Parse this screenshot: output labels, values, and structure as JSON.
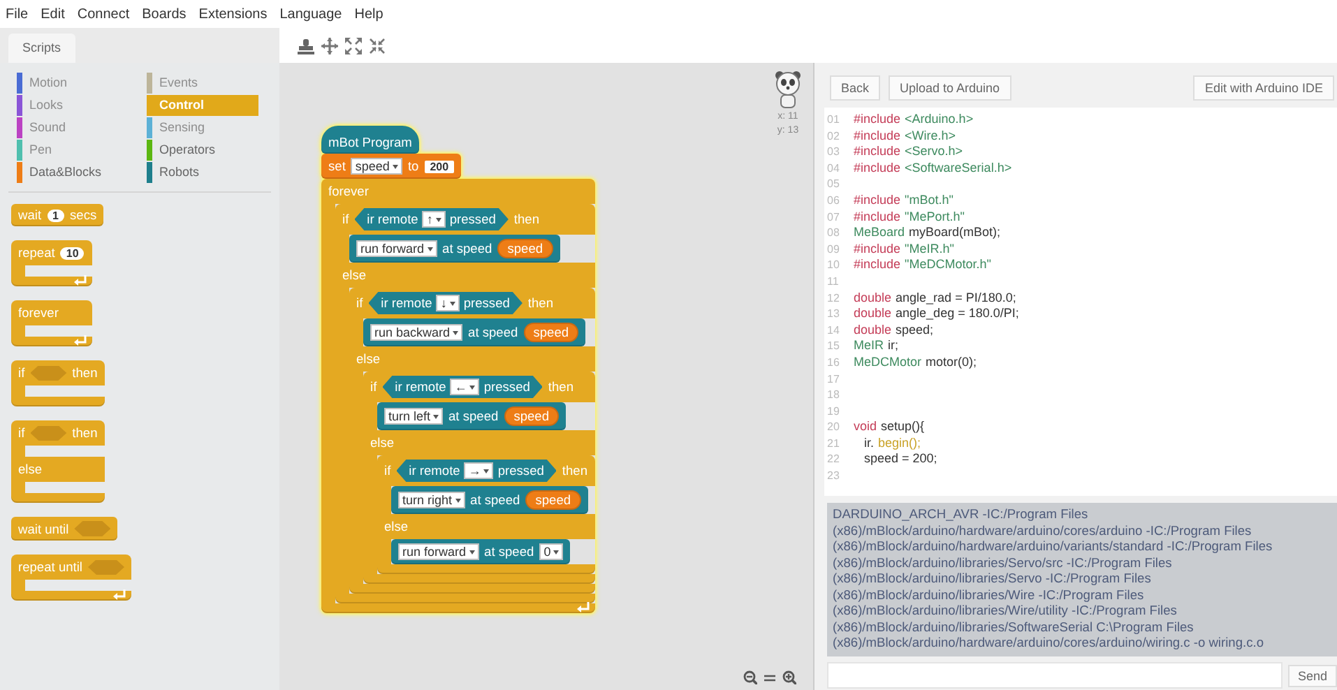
{
  "menu": [
    "File",
    "Edit",
    "Connect",
    "Boards",
    "Extensions",
    "Language",
    "Help"
  ],
  "tabs": [
    {
      "label": "Scripts",
      "selected": true
    }
  ],
  "palette": {
    "categories": [
      {
        "label": "Motion",
        "color": "#4a6cd4",
        "selected": false,
        "disabled": true
      },
      {
        "label": "Events",
        "color": "#bdb59a",
        "selected": false,
        "disabled": true
      },
      {
        "label": "Looks",
        "color": "#8a55d7",
        "selected": false,
        "disabled": true
      },
      {
        "label": "Control",
        "color": "#e1a91a",
        "selected": true,
        "disabled": false
      },
      {
        "label": "Sound",
        "color": "#bb42c3",
        "selected": false,
        "disabled": true
      },
      {
        "label": "Sensing",
        "color": "#5cb1d6",
        "selected": false,
        "disabled": true
      },
      {
        "label": "Pen",
        "color": "#4fbfae",
        "selected": false,
        "disabled": true
      },
      {
        "label": "Operators",
        "color": "#5cb712",
        "selected": false,
        "disabled": false
      },
      {
        "label": "Data&Blocks",
        "color": "#ee7d16",
        "selected": false,
        "disabled": false
      },
      {
        "label": "Robots",
        "color": "#1e7f8c",
        "selected": false,
        "disabled": false
      }
    ],
    "blocks": [
      {
        "kind": "stack",
        "color": "#e4a922",
        "parts": [
          {
            "kind": "label",
            "text": "wait"
          },
          {
            "kind": "number",
            "text": "1"
          },
          {
            "kind": "label",
            "text": "secs"
          }
        ]
      },
      {
        "kind": "c",
        "color": "#e4a922",
        "loop": true,
        "parts": [
          {
            "kind": "label",
            "text": "repeat"
          },
          {
            "kind": "number",
            "text": "10"
          }
        ]
      },
      {
        "kind": "c",
        "color": "#e4a922",
        "loop": true,
        "parts": [
          {
            "kind": "label",
            "text": "forever"
          }
        ]
      },
      {
        "kind": "c",
        "color": "#e4a922",
        "loop": false,
        "parts": [
          {
            "kind": "label",
            "text": "if"
          },
          {
            "kind": "slot"
          },
          {
            "kind": "label",
            "text": "then"
          }
        ]
      },
      {
        "kind": "if_else",
        "color": "#e4a922",
        "parts": [
          {
            "kind": "label",
            "text": "if"
          },
          {
            "kind": "slot"
          },
          {
            "kind": "label",
            "text": "then"
          }
        ],
        "else_parts": [
          {
            "kind": "label",
            "text": "else"
          }
        ]
      },
      {
        "kind": "stack",
        "color": "#e4a922",
        "parts": [
          {
            "kind": "label",
            "text": "wait until"
          },
          {
            "kind": "slot"
          }
        ]
      },
      {
        "kind": "c",
        "color": "#e4a922",
        "loop": true,
        "parts": [
          {
            "kind": "label",
            "text": "repeat until"
          },
          {
            "kind": "slot"
          }
        ]
      }
    ]
  },
  "script": [
    {
      "kind": "hat",
      "color": "#1f8190",
      "parts": [
        {
          "kind": "label",
          "text": "mBot Program"
        }
      ]
    },
    {
      "kind": "stack",
      "color": "#ee7d16",
      "parts": [
        {
          "kind": "label",
          "text": "set"
        },
        {
          "kind": "dropdown",
          "text": "speed"
        },
        {
          "kind": "label",
          "text": "to"
        },
        {
          "kind": "number",
          "text": "200"
        }
      ]
    },
    {
      "kind": "c",
      "color": "#e4a922",
      "loop": true,
      "parts": [
        {
          "kind": "label",
          "text": "forever"
        }
      ],
      "children": [
        {
          "kind": "if_else",
          "color": "#e4a922",
          "parts": [
            {
              "kind": "label",
              "text": "if"
            },
            {
              "kind": "boolean",
              "parts": [
                {
                  "kind": "label",
                  "text": "ir remote"
                },
                {
                  "kind": "dropdown",
                  "text": "↑"
                },
                {
                  "kind": "label",
                  "text": "pressed"
                }
              ]
            },
            {
              "kind": "label",
              "text": "then"
            }
          ],
          "children": [
            {
              "kind": "stack",
              "color": "#1f8190",
              "parts": [
                {
                  "kind": "dropdown",
                  "text": "run forward"
                },
                {
                  "kind": "label",
                  "text": "at speed"
                },
                {
                  "kind": "reporter",
                  "text": "speed"
                }
              ]
            }
          ],
          "else_parts": [
            {
              "kind": "label",
              "text": "else"
            }
          ],
          "else_children": [
            {
              "kind": "if_else",
              "color": "#e4a922",
              "parts": [
                {
                  "kind": "label",
                  "text": "if"
                },
                {
                  "kind": "boolean",
                  "parts": [
                    {
                      "kind": "label",
                      "text": "ir remote"
                    },
                    {
                      "kind": "dropdown",
                      "text": "↓"
                    },
                    {
                      "kind": "label",
                      "text": "pressed"
                    }
                  ]
                },
                {
                  "kind": "label",
                  "text": "then"
                }
              ],
              "children": [
                {
                  "kind": "stack",
                  "color": "#1f8190",
                  "parts": [
                    {
                      "kind": "dropdown",
                      "text": "run backward"
                    },
                    {
                      "kind": "label",
                      "text": "at speed"
                    },
                    {
                      "kind": "reporter",
                      "text": "speed"
                    }
                  ]
                }
              ],
              "else_parts": [
                {
                  "kind": "label",
                  "text": "else"
                }
              ],
              "else_children": [
                {
                  "kind": "if_else",
                  "color": "#e4a922",
                  "parts": [
                    {
                      "kind": "label",
                      "text": "if"
                    },
                    {
                      "kind": "boolean",
                      "parts": [
                        {
                          "kind": "label",
                          "text": "ir remote"
                        },
                        {
                          "kind": "dropdown",
                          "text": "←"
                        },
                        {
                          "kind": "label",
                          "text": "pressed"
                        }
                      ]
                    },
                    {
                      "kind": "label",
                      "text": "then"
                    }
                  ],
                  "children": [
                    {
                      "kind": "stack",
                      "color": "#1f8190",
                      "parts": [
                        {
                          "kind": "dropdown",
                          "text": "turn left"
                        },
                        {
                          "kind": "label",
                          "text": "at speed"
                        },
                        {
                          "kind": "reporter",
                          "text": "speed"
                        }
                      ]
                    }
                  ],
                  "else_parts": [
                    {
                      "kind": "label",
                      "text": "else"
                    }
                  ],
                  "else_children": [
                    {
                      "kind": "if_else",
                      "color": "#e4a922",
                      "parts": [
                        {
                          "kind": "label",
                          "text": "if"
                        },
                        {
                          "kind": "boolean",
                          "parts": [
                            {
                              "kind": "label",
                              "text": "ir remote"
                            },
                            {
                              "kind": "dropdown",
                              "text": "→"
                            },
                            {
                              "kind": "label",
                              "text": "pressed"
                            }
                          ]
                        },
                        {
                          "kind": "label",
                          "text": "then"
                        }
                      ],
                      "children": [
                        {
                          "kind": "stack",
                          "color": "#1f8190",
                          "parts": [
                            {
                              "kind": "dropdown",
                              "text": "turn right"
                            },
                            {
                              "kind": "label",
                              "text": "at speed"
                            },
                            {
                              "kind": "reporter",
                              "text": "speed"
                            }
                          ]
                        }
                      ],
                      "else_parts": [
                        {
                          "kind": "label",
                          "text": "else"
                        }
                      ],
                      "else_children": [
                        {
                          "kind": "stack",
                          "color": "#1f8190",
                          "parts": [
                            {
                              "kind": "dropdown",
                              "text": "run forward"
                            },
                            {
                              "kind": "label",
                              "text": "at speed"
                            },
                            {
                              "kind": "round_dropdown",
                              "text": "0"
                            }
                          ]
                        }
                      ]
                    }
                  ]
                }
              ]
            }
          ]
        }
      ]
    }
  ],
  "sprite": {
    "x": "x: 11",
    "y": "y: 13"
  },
  "code_panel": {
    "buttons": [
      "Back",
      "Upload to Arduino"
    ],
    "edit_button": "Edit with Arduino IDE",
    "lines": [
      {
        "no": "01",
        "tokens": [
          {
            "kind": "directive",
            "text": "#include"
          },
          {
            "kind": "header",
            "text": "<Arduino.h>"
          }
        ]
      },
      {
        "no": "02",
        "tokens": [
          {
            "kind": "directive",
            "text": "#include"
          },
          {
            "kind": "header",
            "text": "<Wire.h>"
          }
        ]
      },
      {
        "no": "03",
        "tokens": [
          {
            "kind": "directive",
            "text": "#include"
          },
          {
            "kind": "header",
            "text": "<Servo.h>"
          }
        ]
      },
      {
        "no": "04",
        "tokens": [
          {
            "kind": "directive",
            "text": "#include"
          },
          {
            "kind": "header",
            "text": "<SoftwareSerial.h>"
          }
        ]
      },
      {
        "no": "05"
      },
      {
        "no": "06",
        "tokens": [
          {
            "kind": "directive",
            "text": "#include"
          },
          {
            "kind": "header",
            "text": "\"mBot.h\""
          }
        ]
      },
      {
        "no": "07",
        "tokens": [
          {
            "kind": "directive",
            "text": "#include"
          },
          {
            "kind": "header",
            "text": "\"MePort.h\""
          }
        ]
      },
      {
        "no": "08",
        "tokens": [
          {
            "kind": "type",
            "text": "MeBoard"
          },
          {
            "kind": "plain",
            "text": "myBoard(mBot);"
          }
        ]
      },
      {
        "no": "09",
        "tokens": [
          {
            "kind": "directive",
            "text": "#include"
          },
          {
            "kind": "header",
            "text": "\"MeIR.h\""
          }
        ]
      },
      {
        "no": "10",
        "tokens": [
          {
            "kind": "directive",
            "text": "#include"
          },
          {
            "kind": "header",
            "text": "\"MeDCMotor.h\""
          }
        ]
      },
      {
        "no": "11"
      },
      {
        "no": "12",
        "tokens": [
          {
            "kind": "keyword",
            "text": "double"
          },
          {
            "kind": "plain",
            "text": "angle_rad = PI/180.0;"
          }
        ]
      },
      {
        "no": "13",
        "tokens": [
          {
            "kind": "keyword",
            "text": "double"
          },
          {
            "kind": "plain",
            "text": "angle_deg = 180.0/PI;"
          }
        ]
      },
      {
        "no": "14",
        "tokens": [
          {
            "kind": "keyword",
            "text": "double"
          },
          {
            "kind": "plain",
            "text": "speed;"
          }
        ]
      },
      {
        "no": "15",
        "tokens": [
          {
            "kind": "type",
            "text": "MeIR"
          },
          {
            "kind": "plain",
            "text": "ir;"
          }
        ]
      },
      {
        "no": "16",
        "tokens": [
          {
            "kind": "type",
            "text": "MeDCMotor"
          },
          {
            "kind": "plain",
            "text": "motor(0);"
          }
        ]
      },
      {
        "no": "17"
      },
      {
        "no": "18"
      },
      {
        "no": "19"
      },
      {
        "no": "20",
        "tokens": [
          {
            "kind": "keyword",
            "text": "void"
          },
          {
            "kind": "plain",
            "text": "setup(){"
          }
        ]
      },
      {
        "no": "21",
        "tokens": [
          {
            "kind": "plain",
            "text": "   ir."
          },
          {
            "kind": "method",
            "text": "begin();"
          }
        ]
      },
      {
        "no": "22",
        "tokens": [
          {
            "kind": "plain",
            "text": "   speed = 200;"
          }
        ]
      },
      {
        "no": "23"
      }
    ],
    "console": [
      "DARDUINO_ARCH_AVR -IC:/Program Files",
      "(x86)/mBlock/arduino/hardware/arduino/cores/arduino -IC:/Program Files",
      "(x86)/mBlock/arduino/hardware/arduino/variants/standard -IC:/Program Files",
      "(x86)/mBlock/arduino/libraries/Servo/src -IC:/Program Files",
      "(x86)/mBlock/arduino/libraries/Servo -IC:/Program Files",
      "(x86)/mBlock/arduino/libraries/Wire -IC:/Program Files",
      "(x86)/mBlock/arduino/libraries/Wire/utility -IC:/Program Files",
      "(x86)/mBlock/arduino/libraries/SoftwareSerial C:\\Program Files",
      "(x86)/mBlock/arduino/hardware/arduino/cores/arduino/wiring.c -o wiring.c.o"
    ],
    "send_button": "Send"
  }
}
